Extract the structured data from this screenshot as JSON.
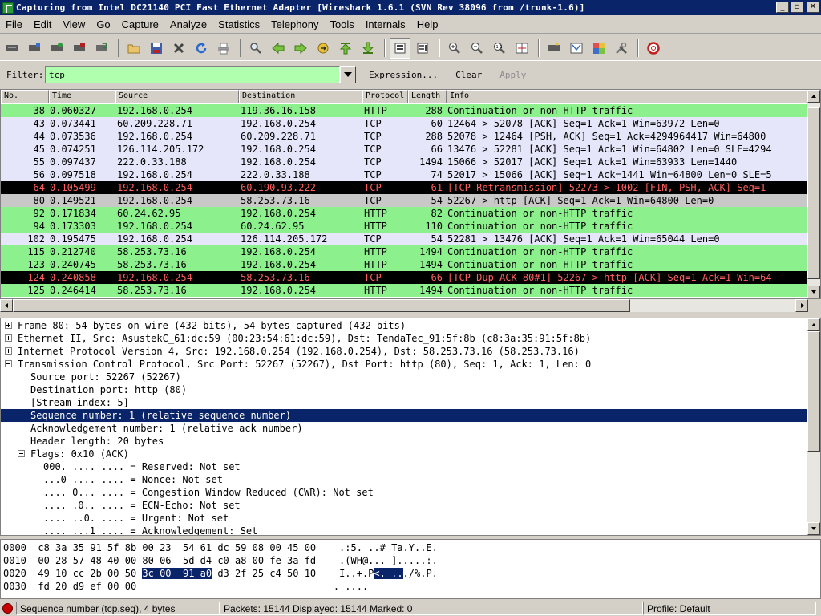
{
  "window": {
    "title": "Capturing from Intel DC21140 PCI Fast Ethernet Adapter    [Wireshark 1.6.1  (SVN Rev 38096 from /trunk-1.6)]",
    "buttons": [
      "_",
      "▫",
      "✕"
    ]
  },
  "menu": [
    "File",
    "Edit",
    "View",
    "Go",
    "Capture",
    "Analyze",
    "Statistics",
    "Telephony",
    "Tools",
    "Internals",
    "Help"
  ],
  "toolbar": {
    "icons": [
      "list-interfaces-icon",
      "capture-options-icon",
      "start-capture-icon",
      "stop-capture-icon",
      "restart-capture-icon",
      "open-file-icon",
      "save-file-icon",
      "close-file-icon",
      "reload-icon",
      "print-icon",
      "find-icon",
      "go-back-icon",
      "go-forward-icon",
      "go-to-packet-icon",
      "go-first-icon",
      "go-last-icon",
      "colorize-icon",
      "auto-scroll-icon",
      "zoom-in-icon",
      "zoom-out-icon",
      "zoom-normal-icon",
      "resize-columns-icon",
      "capture-filters-icon",
      "display-filters-icon",
      "coloring-rules-icon",
      "preferences-icon",
      "help-icon"
    ]
  },
  "filter": {
    "label": "Filter:",
    "value": "tcp",
    "expression_label": "Expression...",
    "clear_label": "Clear",
    "apply_label": "Apply"
  },
  "packet_list": {
    "columns": [
      "No.",
      "Time",
      "Source",
      "Destination",
      "Protocol",
      "Length",
      "Info"
    ],
    "rows": [
      {
        "no": "38",
        "time": "0.060327",
        "src": "192.168.0.254",
        "dst": "119.36.16.158",
        "proto": "HTTP",
        "len": "288",
        "info": "Continuation or non-HTTP traffic",
        "bg": "#8cf08c",
        "fg": "#000000"
      },
      {
        "no": "43",
        "time": "0.073441",
        "src": "60.209.228.71",
        "dst": "192.168.0.254",
        "proto": "TCP",
        "len": "60",
        "info": "12464 > 52078 [ACK] Seq=1 Ack=1 Win=63972 Len=0",
        "bg": "#e6e6fa",
        "fg": "#000000"
      },
      {
        "no": "44",
        "time": "0.073536",
        "src": "192.168.0.254",
        "dst": "60.209.228.71",
        "proto": "TCP",
        "len": "288",
        "info": "52078 > 12464 [PSH, ACK] Seq=1 Ack=4294964417 Win=64800",
        "bg": "#e6e6fa",
        "fg": "#000000"
      },
      {
        "no": "45",
        "time": "0.074251",
        "src": "126.114.205.172",
        "dst": "192.168.0.254",
        "proto": "TCP",
        "len": "66",
        "info": "13476 > 52281 [ACK] Seq=1 Ack=1 Win=64802 Len=0 SLE=4294",
        "bg": "#e6e6fa",
        "fg": "#000000"
      },
      {
        "no": "55",
        "time": "0.097437",
        "src": "222.0.33.188",
        "dst": "192.168.0.254",
        "proto": "TCP",
        "len": "1494",
        "info": "15066 > 52017 [ACK] Seq=1 Ack=1 Win=63933 Len=1440",
        "bg": "#e6e6fa",
        "fg": "#000000"
      },
      {
        "no": "56",
        "time": "0.097518",
        "src": "192.168.0.254",
        "dst": "222.0.33.188",
        "proto": "TCP",
        "len": "74",
        "info": "52017 > 15066 [ACK] Seq=1 Ack=1441 Win=64800 Len=0 SLE=5",
        "bg": "#e6e6fa",
        "fg": "#000000"
      },
      {
        "no": "64",
        "time": "0.105499",
        "src": "192.168.0.254",
        "dst": "60.190.93.222",
        "proto": "TCP",
        "len": "61",
        "info": "[TCP Retransmission] 52273 > 1002 [FIN, PSH, ACK] Seq=1",
        "bg": "#000000",
        "fg": "#ff5f5f"
      },
      {
        "no": "80",
        "time": "0.149521",
        "src": "192.168.0.254",
        "dst": "58.253.73.16",
        "proto": "TCP",
        "len": "54",
        "info": "52267 > http [ACK] Seq=1 Ack=1 Win=64800 Len=0",
        "bg": "#c8c8c8",
        "fg": "#000000"
      },
      {
        "no": "92",
        "time": "0.171834",
        "src": "60.24.62.95",
        "dst": "192.168.0.254",
        "proto": "HTTP",
        "len": "82",
        "info": "Continuation or non-HTTP traffic",
        "bg": "#8cf08c",
        "fg": "#000000"
      },
      {
        "no": "94",
        "time": "0.173303",
        "src": "192.168.0.254",
        "dst": "60.24.62.95",
        "proto": "HTTP",
        "len": "110",
        "info": "Continuation or non-HTTP traffic",
        "bg": "#8cf08c",
        "fg": "#000000"
      },
      {
        "no": "102",
        "time": "0.195475",
        "src": "192.168.0.254",
        "dst": "126.114.205.172",
        "proto": "TCP",
        "len": "54",
        "info": "52281 > 13476 [ACK] Seq=1 Ack=1 Win=65044 Len=0",
        "bg": "#e6e6fa",
        "fg": "#000000"
      },
      {
        "no": "115",
        "time": "0.212740",
        "src": "58.253.73.16",
        "dst": "192.168.0.254",
        "proto": "HTTP",
        "len": "1494",
        "info": "Continuation or non-HTTP traffic",
        "bg": "#8cf08c",
        "fg": "#000000"
      },
      {
        "no": "123",
        "time": "0.240745",
        "src": "58.253.73.16",
        "dst": "192.168.0.254",
        "proto": "HTTP",
        "len": "1494",
        "info": "Continuation or non-HTTP traffic",
        "bg": "#8cf08c",
        "fg": "#000000"
      },
      {
        "no": "124",
        "time": "0.240858",
        "src": "192.168.0.254",
        "dst": "58.253.73.16",
        "proto": "TCP",
        "len": "66",
        "info": "[TCP Dup ACK 80#1] 52267 > http [ACK] Seq=1 Ack=1 Win=64",
        "bg": "#000000",
        "fg": "#ff5f5f"
      },
      {
        "no": "125",
        "time": "0.246414",
        "src": "58.253.73.16",
        "dst": "192.168.0.254",
        "proto": "HTTP",
        "len": "1494",
        "info": "Continuation or non-HTTP traffic",
        "bg": "#8cf08c",
        "fg": "#000000"
      }
    ]
  },
  "details": [
    {
      "text": "Frame 80: 54 bytes on wire (432 bits), 54 bytes captured (432 bits)",
      "indent": 0,
      "expander": "plus",
      "selected": false
    },
    {
      "text": "Ethernet II, Src: AsustekC_61:dc:59 (00:23:54:61:dc:59), Dst: TendaTec_91:5f:8b (c8:3a:35:91:5f:8b)",
      "indent": 0,
      "expander": "plus",
      "selected": false
    },
    {
      "text": "Internet Protocol Version 4, Src: 192.168.0.254 (192.168.0.254), Dst: 58.253.73.16 (58.253.73.16)",
      "indent": 0,
      "expander": "plus",
      "selected": false
    },
    {
      "text": "Transmission Control Protocol, Src Port: 52267 (52267), Dst Port: http (80), Seq: 1, Ack: 1, Len: 0",
      "indent": 0,
      "expander": "minus",
      "selected": false
    },
    {
      "text": "Source port: 52267 (52267)",
      "indent": 1,
      "expander": "",
      "selected": false
    },
    {
      "text": "Destination port: http (80)",
      "indent": 1,
      "expander": "",
      "selected": false
    },
    {
      "text": "[Stream index: 5]",
      "indent": 1,
      "expander": "",
      "selected": false
    },
    {
      "text": "Sequence number: 1    (relative sequence number)",
      "indent": 1,
      "expander": "",
      "selected": true
    },
    {
      "text": "Acknowledgement number: 1    (relative ack number)",
      "indent": 1,
      "expander": "",
      "selected": false
    },
    {
      "text": "Header length: 20 bytes",
      "indent": 1,
      "expander": "",
      "selected": false
    },
    {
      "text": "Flags: 0x10 (ACK)",
      "indent": 1,
      "expander": "minus",
      "selected": false
    },
    {
      "text": "000. .... .... = Reserved: Not set",
      "indent": 2,
      "expander": "",
      "selected": false
    },
    {
      "text": "...0 .... .... = Nonce: Not set",
      "indent": 2,
      "expander": "",
      "selected": false
    },
    {
      "text": ".... 0... .... = Congestion Window Reduced (CWR): Not set",
      "indent": 2,
      "expander": "",
      "selected": false
    },
    {
      "text": ".... .0.. .... = ECN-Echo: Not set",
      "indent": 2,
      "expander": "",
      "selected": false
    },
    {
      "text": ".... ..0. .... = Urgent: Not set",
      "indent": 2,
      "expander": "",
      "selected": false
    },
    {
      "text": ".... ...1 .... = Acknowledgement: Set",
      "indent": 2,
      "expander": "",
      "selected": false
    }
  ],
  "hex": [
    {
      "offset": "0000",
      "bytes_a": "c8 3a 35 91 5f 8b 00 23  54 61 dc 59 08 00 45 00",
      "bytes_hl": "",
      "bytes_b": "",
      "ascii_a": ".:5._..# Ta.Y..E.",
      "ascii_hl": "",
      "ascii_b": ""
    },
    {
      "offset": "0010",
      "bytes_a": "00 28 57 48 40 00 80 06  5d d4 c0 a8 00 fe 3a fd",
      "bytes_hl": "",
      "bytes_b": "",
      "ascii_a": ".(WH@... ].....:.",
      "ascii_hl": "",
      "ascii_b": ""
    },
    {
      "offset": "0020",
      "bytes_a": "49 10 cc 2b 00 50 ",
      "bytes_hl": "3c 00  91 a0",
      "bytes_b": " d3 2f 25 c4 50 10",
      "ascii_a": "I..+.P",
      "ascii_hl": "<. ..",
      "ascii_b": "./%.P."
    },
    {
      "offset": "0030",
      "bytes_a": "fd 20 d9 ef 00 00",
      "bytes_hl": "",
      "bytes_b": "",
      "ascii_a": ". ....",
      "ascii_hl": "",
      "ascii_b": ""
    }
  ],
  "status": {
    "field": "Sequence number (tcp.seq), 4 bytes",
    "packets": "Packets: 15144 Displayed: 15144 Marked: 0",
    "profile": "Profile: Default"
  }
}
